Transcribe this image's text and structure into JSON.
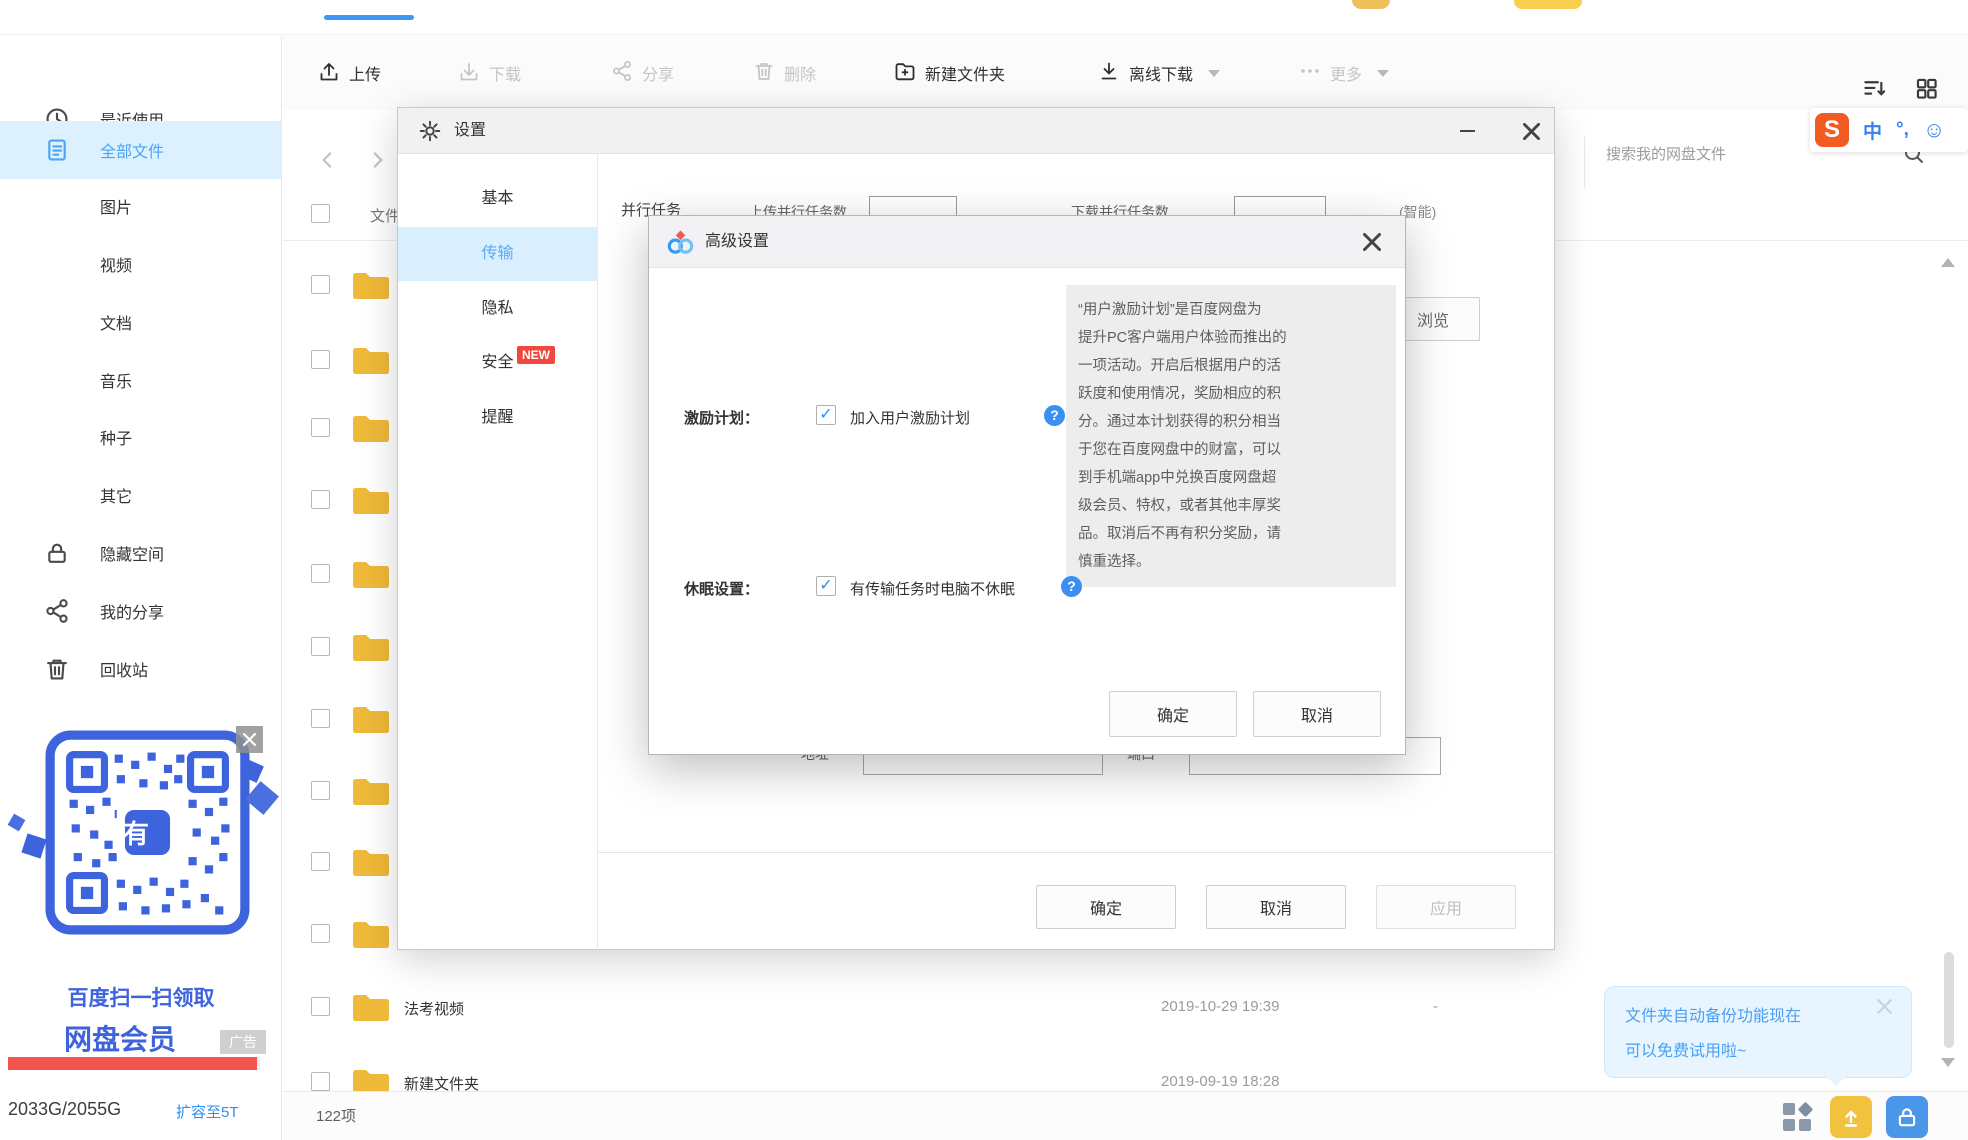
{
  "icons": {
    "check": "✓",
    "sort": "sort-icon",
    "grid": "grid-view-icon",
    "search": "search-icon",
    "gear": "gear-icon",
    "netdisk_logo": "baidu-netdisk-logo"
  },
  "ime": {
    "logo": "S",
    "lang": "中",
    "punct": "°,",
    "face": "☺"
  },
  "search": {
    "placeholder": "搜索我的网盘文件"
  },
  "toolbar": {
    "items": [
      {
        "label": "上传",
        "enabled": true
      },
      {
        "label": "下载",
        "enabled": false
      },
      {
        "label": "分享",
        "enabled": false
      },
      {
        "label": "删除",
        "enabled": false
      },
      {
        "label": "新建文件夹",
        "enabled": true
      },
      {
        "label": "离线下载",
        "enabled": true
      },
      {
        "label": "更多",
        "enabled": false
      }
    ]
  },
  "sidebar": {
    "items": [
      {
        "label": "最近使用"
      },
      {
        "label": "全部文件",
        "active": true
      },
      {
        "label": "图片"
      },
      {
        "label": "视频"
      },
      {
        "label": "文档"
      },
      {
        "label": "音乐"
      },
      {
        "label": "种子"
      },
      {
        "label": "其它"
      },
      {
        "label": "隐藏空间"
      },
      {
        "label": "我的分享"
      },
      {
        "label": "回收站"
      }
    ]
  },
  "ad": {
    "caption1": "百度扫一扫领取",
    "caption2": "网盘会员",
    "badge": "广告",
    "qr_char": "有"
  },
  "storage": {
    "usage": "2033G/2055G",
    "upgrade": "扩容至5T",
    "percent": 98.9
  },
  "list": {
    "header_label": "文件",
    "count": "122项",
    "rows": [
      {
        "name": "",
        "date": "",
        "size": ""
      },
      {
        "name": "",
        "date": "",
        "size": ""
      },
      {
        "name": "",
        "date": "",
        "size": ""
      },
      {
        "name": "",
        "date": "",
        "size": ""
      },
      {
        "name": "",
        "date": "",
        "size": ""
      },
      {
        "name": "",
        "date": "",
        "size": ""
      },
      {
        "name": "",
        "date": "",
        "size": ""
      },
      {
        "name": "",
        "date": "",
        "size": ""
      },
      {
        "name": "",
        "date": "",
        "size": ""
      },
      {
        "name": "",
        "date": "",
        "size": ""
      },
      {
        "name": "法考视频",
        "date": "2019-10-29 19:39",
        "size": "-"
      },
      {
        "name": "新建文件夹",
        "date": "2019-09-19 18:28",
        "size": ""
      }
    ]
  },
  "settings": {
    "title": "设置",
    "tabs": [
      {
        "label": "基本"
      },
      {
        "label": "传输",
        "active": true
      },
      {
        "label": "隐私"
      },
      {
        "label": "安全",
        "badge": "NEW"
      },
      {
        "label": "提醒"
      }
    ],
    "fragments": {
      "parallel": "并行任务",
      "upload_count": "上传并行任务数",
      "download_count": "下载并行任务数",
      "smart": "(智能)",
      "browse": "浏览",
      "address": "地址",
      "port": "端口"
    },
    "ok": "确定",
    "cancel": "取消",
    "apply": "应用"
  },
  "advanced": {
    "title": "高级设置",
    "incentive": {
      "label": "激励计划：",
      "checkbox_label": "加入用户激励计划",
      "checked": true,
      "help": "?"
    },
    "sleep": {
      "label": "休眠设置：",
      "checkbox_label": "有传输任务时电脑不休眠",
      "checked": true,
      "help": "?"
    },
    "tooltip_lines": [
      "“用户激励计划”是百度网盘为",
      "提升PC客户端用户体验而推出的",
      "一项活动。开启后根据用户的活",
      "跃度和使用情况，奖励相应的积",
      "分。通过本计划获得的积分相当",
      "于您在百度网盘中的财富，可以",
      "到手机端app中兑换百度网盘超",
      "级会员、特权，或者其他丰厚奖",
      "品。取消后不再有积分奖励，请",
      "慎重选择。"
    ],
    "ok": "确定",
    "cancel": "取消"
  },
  "toast": {
    "line1": "文件夹自动备份功能现在",
    "line2": "可以免费试用啦~"
  }
}
